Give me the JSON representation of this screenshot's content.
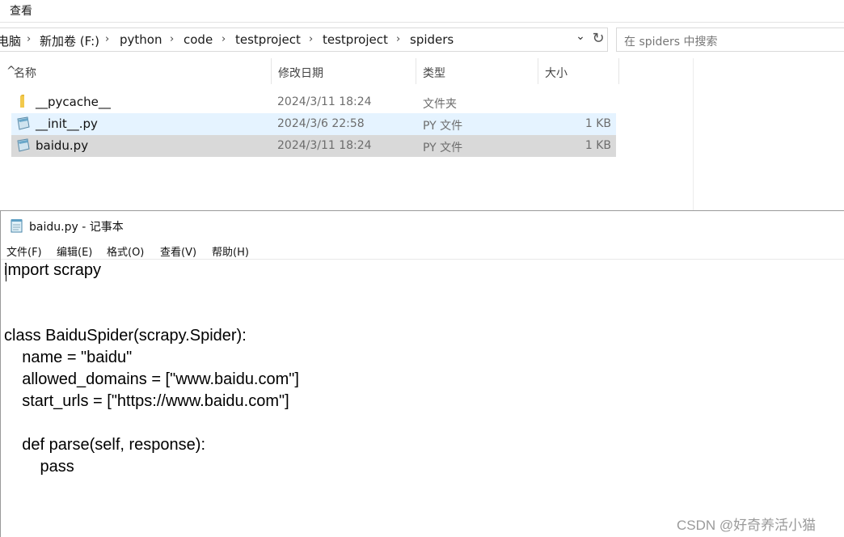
{
  "explorer": {
    "ribbon": {
      "view_tab": "查看"
    },
    "breadcrumb": [
      {
        "label": "电脑"
      },
      {
        "label": "新加卷 (F:)"
      },
      {
        "label": "python"
      },
      {
        "label": "code"
      },
      {
        "label": "testproject"
      },
      {
        "label": "testproject"
      },
      {
        "label": "spiders"
      }
    ],
    "breadcrumb_separator": "›",
    "dropdown_glyph": "⌄",
    "refresh_glyph": "↻",
    "search": {
      "placeholder": "在 spiders 中搜索"
    },
    "columns": {
      "name": "名称",
      "modified": "修改日期",
      "type": "类型",
      "size": "大小"
    },
    "sort_glyph": "^",
    "files": [
      {
        "name": "__pycache__",
        "modified": "2024/3/11 18:24",
        "type": "文件夹",
        "size": "",
        "icon": "folder-icon",
        "state": "normal"
      },
      {
        "name": "__init__.py",
        "modified": "2024/3/6 22:58",
        "type": "PY 文件",
        "size": "1 KB",
        "icon": "python-file-icon",
        "state": "hover"
      },
      {
        "name": "baidu.py",
        "modified": "2024/3/11 18:24",
        "type": "PY 文件",
        "size": "1 KB",
        "icon": "python-file-icon",
        "state": "selected"
      }
    ],
    "colors": {
      "hover": "#e5f3ff",
      "selected": "#d9d9d9",
      "folder": "#f2c94c"
    }
  },
  "notepad": {
    "title": "baidu.py - 记事本",
    "menu": [
      {
        "label": "文件(F)"
      },
      {
        "label": "编辑(E)"
      },
      {
        "label": "格式(O)"
      },
      {
        "label": "查看(V)"
      },
      {
        "label": "帮助(H)"
      }
    ],
    "lines": [
      "import scrapy",
      "",
      "",
      "class BaiduSpider(scrapy.Spider):",
      "    name = \"baidu\"",
      "    allowed_domains = [\"www.baidu.com\"]",
      "    start_urls = [\"https://www.baidu.com\"]",
      "",
      "    def parse(self, response):",
      "        pass"
    ]
  },
  "watermark": "CSDN @好奇养活小猫"
}
